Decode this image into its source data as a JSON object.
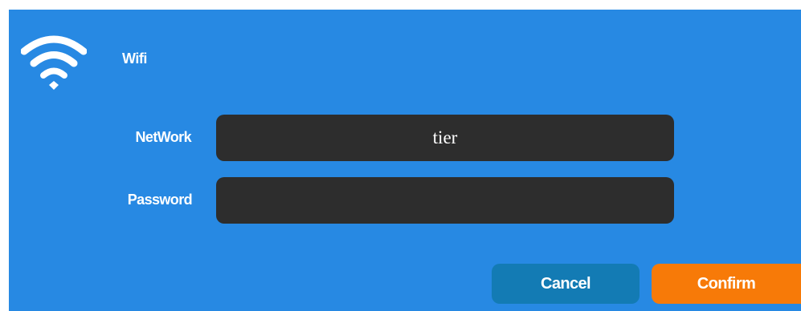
{
  "dialog": {
    "title": "Wifi",
    "icon": "wifi-icon",
    "background": "#2789e3"
  },
  "form": {
    "network_label": "NetWork",
    "network_value": "tier",
    "password_label": "Password",
    "password_value": ""
  },
  "buttons": {
    "cancel_label": "Cancel",
    "confirm_label": "Confirm",
    "cancel_color": "#137bb4",
    "confirm_color": "#f77a08"
  }
}
